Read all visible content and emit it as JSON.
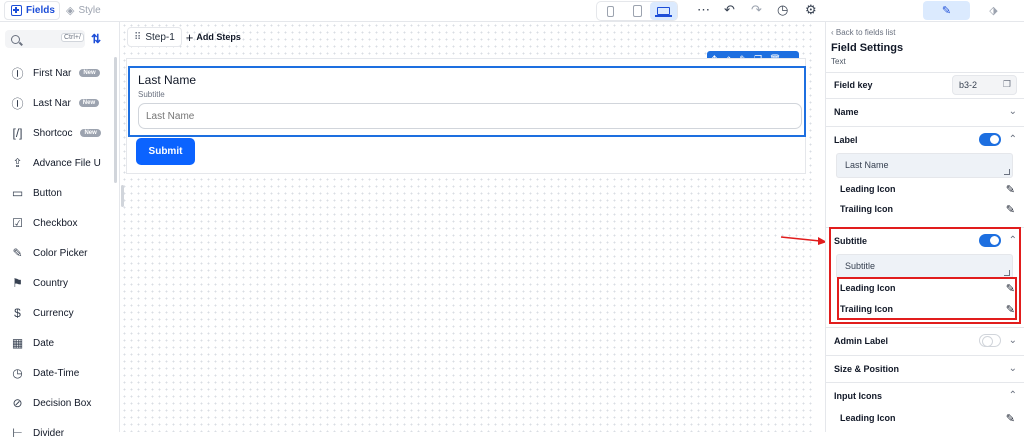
{
  "topbar": {
    "fields_tab": "Fields",
    "style_tab": "Style",
    "devices": [
      "phone",
      "tablet",
      "laptop"
    ],
    "active_device": "laptop",
    "more_icon": "⋯",
    "undo_icon": "↶",
    "redo_icon": "↷",
    "history_icon": "◷",
    "settings_icon": "⚙",
    "panel_tabs": [
      "edit-icon",
      "paint-icon"
    ],
    "panel_tab_glyphs": [
      "✎",
      "⬗"
    ]
  },
  "sidebar": {
    "search_shortcut": "Ctrl+/",
    "sort_icon": "⇅",
    "items": [
      {
        "label": "First Nar",
        "icon": "Ⓘ",
        "badge": "New"
      },
      {
        "label": "Last Nar",
        "icon": "Ⓘ",
        "badge": "New"
      },
      {
        "label": "Shortcoc",
        "icon": "[/]",
        "badge": "New"
      },
      {
        "label": "Advance File U",
        "icon": "⇪",
        "badge": ""
      },
      {
        "label": "Button",
        "icon": "▭",
        "badge": ""
      },
      {
        "label": "Checkbox",
        "icon": "☑",
        "badge": ""
      },
      {
        "label": "Color Picker",
        "icon": "✎",
        "badge": ""
      },
      {
        "label": "Country",
        "icon": "⚑",
        "badge": ""
      },
      {
        "label": "Currency",
        "icon": "$",
        "badge": ""
      },
      {
        "label": "Date",
        "icon": "▦",
        "badge": ""
      },
      {
        "label": "Date-Time",
        "icon": "◷",
        "badge": ""
      },
      {
        "label": "Decision Box",
        "icon": "⊘",
        "badge": ""
      },
      {
        "label": "Divider",
        "icon": "⊢",
        "badge": ""
      }
    ]
  },
  "canvas": {
    "step_label": "Step-1",
    "add_steps_label": "Add Steps",
    "field_label": "Last Name",
    "field_subtitle": "Subtitle",
    "field_placeholder": "Last Name",
    "submit_label": "Submit",
    "toolbar_icons": [
      "✥",
      "⬗",
      "✎",
      "❐",
      "🗑",
      "⌄"
    ]
  },
  "panel": {
    "back_label": "Back to fields list",
    "title": "Field Settings",
    "type": "Text",
    "field_key_label": "Field key",
    "field_key_value": "b3-2",
    "name_label": "Name",
    "label_label": "Label",
    "label_value": "Last Name",
    "leading_icon_label": "Leading Icon",
    "trailing_icon_label": "Trailing Icon",
    "subtitle_label": "Subtitle",
    "subtitle_value": "Subtitle",
    "sub_leading_icon_label": "Leading Icon",
    "sub_trailing_icon_label": "Trailing Icon",
    "admin_label": "Admin Label",
    "size_position_label": "Size & Position",
    "input_icons_label": "Input Icons",
    "input_leading_icon_label": "Leading Icon",
    "toggles": {
      "label": true,
      "subtitle": true,
      "admin_label": false
    }
  },
  "colors": {
    "accent": "#1d6fe0",
    "annotation": "#e11d1d",
    "submit": "#0b63ff"
  }
}
